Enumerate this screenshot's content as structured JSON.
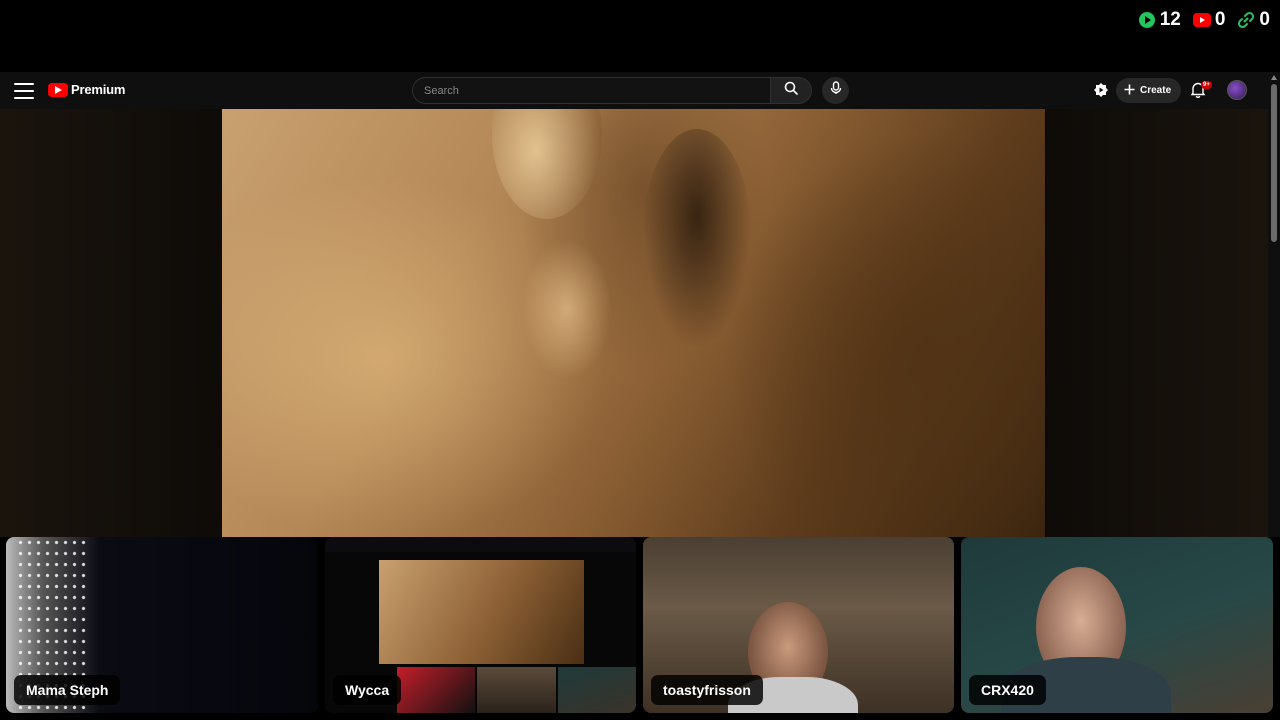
{
  "overlay": {
    "counters": [
      {
        "icon": "play-icon",
        "value": "12",
        "color": "#22c55e"
      },
      {
        "icon": "youtube-icon",
        "value": "0",
        "color": "#ff0000"
      },
      {
        "icon": "link-icon",
        "value": "0",
        "color": "#22c55e"
      }
    ]
  },
  "header": {
    "menu_icon": "hamburger-icon",
    "logo_text": "Premium",
    "search_placeholder": "Search",
    "create_label": "Create",
    "notifications_badge": "9+",
    "brand_color": "#ff0000"
  },
  "participants": [
    {
      "name": "Mama Steph"
    },
    {
      "name": "Wycca"
    },
    {
      "name": "toastyfrisson"
    },
    {
      "name": "CRX420"
    }
  ]
}
